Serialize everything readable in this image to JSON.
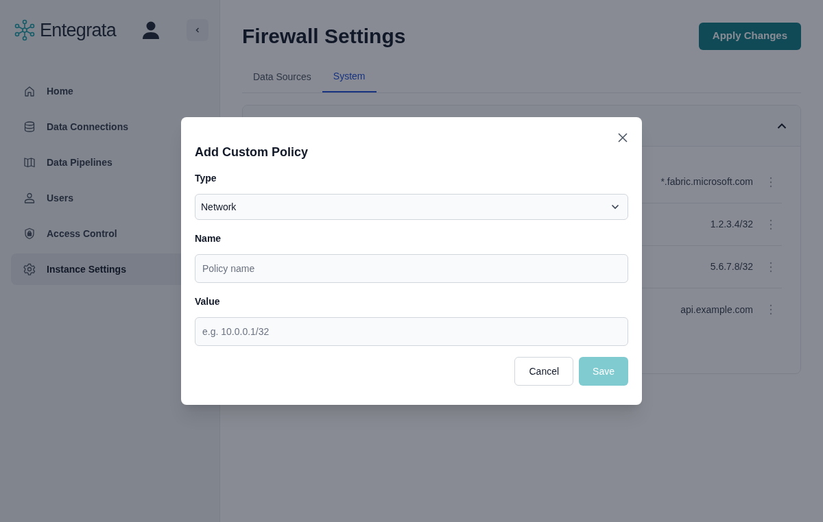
{
  "brand": {
    "name": "Entegrata"
  },
  "sidebar": {
    "items": [
      {
        "label": "Home",
        "selected": false
      },
      {
        "label": "Data Connections",
        "selected": false
      },
      {
        "label": "Data Pipelines",
        "selected": false
      },
      {
        "label": "Users",
        "selected": false
      },
      {
        "label": "Access Control",
        "selected": false
      },
      {
        "label": "Instance Settings",
        "selected": true
      }
    ]
  },
  "page": {
    "title": "Firewall Settings",
    "apply_button": "Apply Changes"
  },
  "tabs": [
    {
      "label": "Data Sources",
      "selected": false
    },
    {
      "label": "System",
      "selected": true
    }
  ],
  "policy_card": {
    "expanded": true,
    "rows": [
      {
        "value": "*.fabric.microsoft.com"
      },
      {
        "value": "1.2.3.4/32"
      },
      {
        "value": "5.6.7.8/32"
      },
      {
        "value": "api.example.com"
      }
    ]
  },
  "dialog": {
    "title": "Add Custom Policy",
    "fields": [
      {
        "kind": "select",
        "label": "Type",
        "value": "Network"
      },
      {
        "kind": "text",
        "label": "Name",
        "placeholder": "Policy name"
      },
      {
        "kind": "text",
        "label": "Value",
        "placeholder": "e.g. 10.0.0.1/32"
      }
    ],
    "buttons": [
      {
        "label": "Cancel",
        "kind": "secondary",
        "disabled": false
      },
      {
        "label": "Save",
        "kind": "primary",
        "disabled": true
      }
    ]
  }
}
